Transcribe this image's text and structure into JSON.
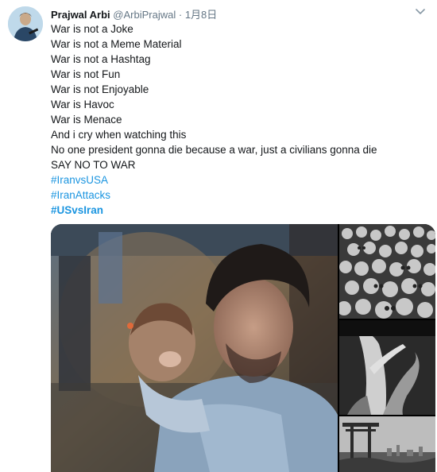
{
  "tweet": {
    "author": {
      "name": "Prajwal Arbi",
      "handle": "@ArbiPrajwal",
      "separator": "·",
      "date": "1月8日"
    },
    "lines": [
      "War is not a Joke",
      "War is not a Meme Material",
      "War is not a Hashtag",
      "War is not Fun",
      "War is not Enjoyable",
      "War is Havoc",
      "War is Menace",
      "And i cry when watching this",
      "No one president gonna die because a war, just a civilians gonna die",
      "SAY NO TO WAR"
    ],
    "hashtags": [
      "#IranvsUSA",
      "#IranAttacks",
      "#USvsIran"
    ],
    "media": {
      "count": 4,
      "items": [
        "man-holding-child-photo",
        "skulls-pile-photo",
        "burnt-tree-photo",
        "torii-gate-ruins-photo"
      ]
    }
  },
  "icons": {
    "more": "chevron-down-icon",
    "avatar": "avatar-icon"
  },
  "colors": {
    "link": "#1b95e0",
    "secondary_text": "#657786",
    "primary_text": "#14171a"
  }
}
